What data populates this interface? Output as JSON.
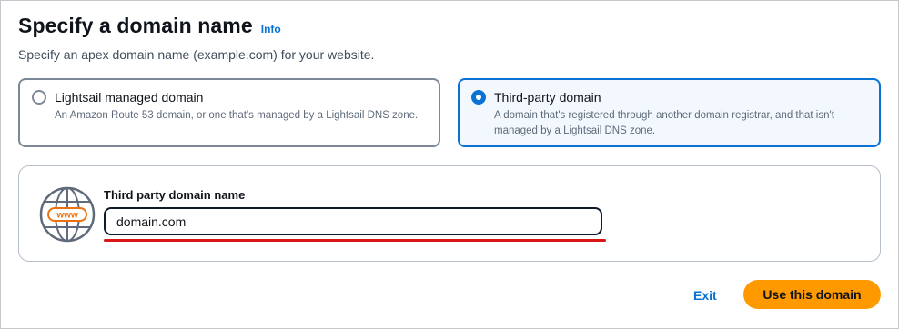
{
  "header": {
    "title": "Specify a domain name",
    "info_label": "Info",
    "subtitle": "Specify an apex domain name (example.com) for your website."
  },
  "domain_type": {
    "selected": "third-party",
    "options": [
      {
        "title": "Lightsail managed domain",
        "description": "An Amazon Route 53 domain, or one that's managed by a Lightsail DNS zone."
      },
      {
        "title": "Third-party domain",
        "description": "A domain that's registered through another domain registrar, and that isn't managed by a Lightsail DNS zone."
      }
    ]
  },
  "domain_field": {
    "icon": "www-globe-icon",
    "label": "Third party domain name",
    "value": "domain.com"
  },
  "actions": {
    "exit_label": "Exit",
    "primary_label": "Use this domain"
  },
  "colors": {
    "accent": "#0972d3",
    "primary_button": "#ff9900",
    "underline": "#d91515",
    "globe_text": "#ec7211"
  }
}
